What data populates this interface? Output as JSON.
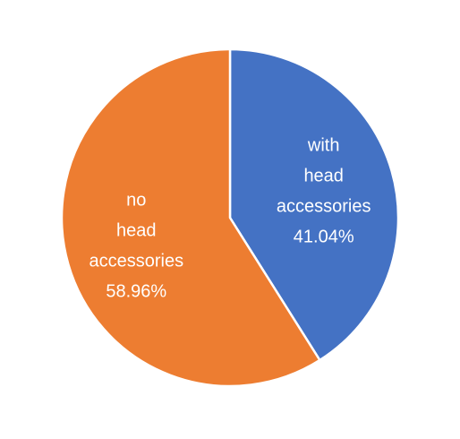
{
  "chart_data": {
    "type": "pie",
    "slices": [
      {
        "label_lines": [
          "with",
          "head",
          "accessories"
        ],
        "value": 41.04,
        "value_label": "41.04%",
        "color": "#4472c4"
      },
      {
        "label_lines": [
          "no",
          "head",
          "accessories"
        ],
        "value": 58.96,
        "value_label": "58.96%",
        "color": "#ed7d31"
      }
    ],
    "start_angle": "12 o'clock",
    "direction": "clockwise",
    "slice_border_color": "#ffffff",
    "legend": "none"
  }
}
